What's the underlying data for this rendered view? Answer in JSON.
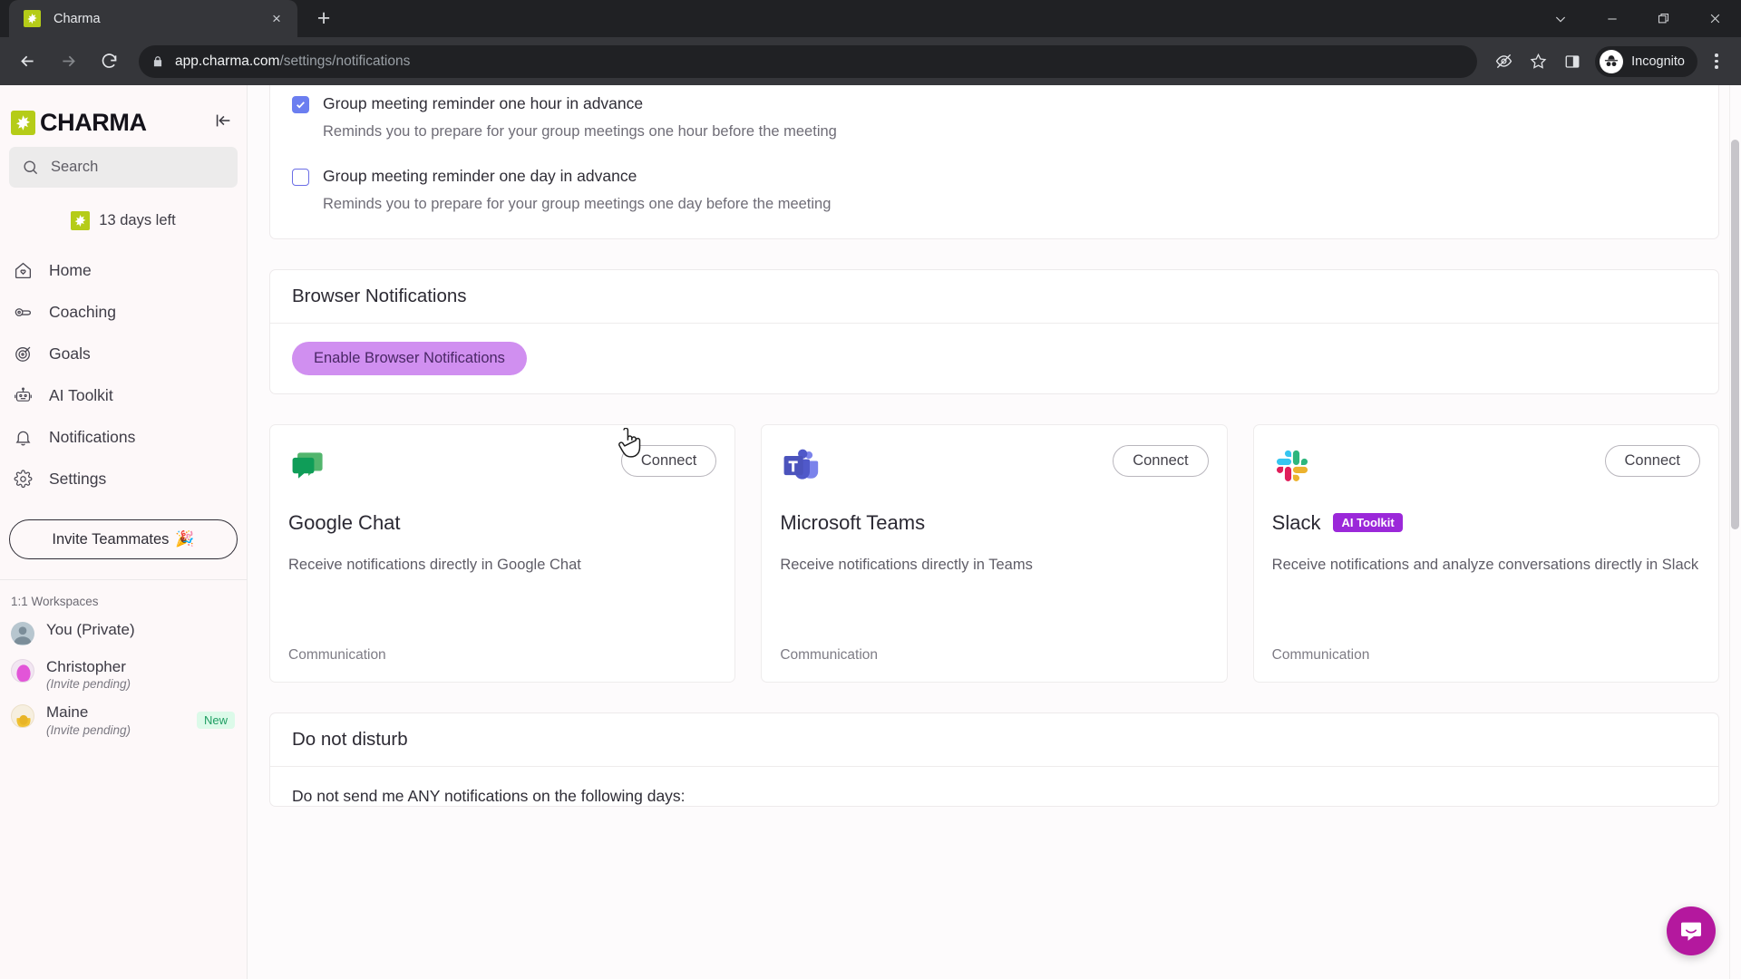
{
  "browser": {
    "tab": {
      "title": "Charma",
      "favicon": "charma-starburst-icon",
      "close": "×"
    },
    "new_tab_label": "+",
    "window_controls": {
      "dropdown": "chevron-down-icon",
      "minimize": "minimize-icon",
      "maximize": "maximize-icon",
      "close": "close-icon"
    },
    "url": {
      "domain": "app.charma.com",
      "path": "/settings/notifications"
    },
    "profile": {
      "label": "Incognito"
    },
    "toolbar_icons": [
      "eye-slash-icon",
      "star-icon",
      "side-panel-icon"
    ]
  },
  "sidebar": {
    "brand": "CHARMA",
    "collapse_icon": "collapse-left-icon",
    "search": {
      "placeholder": "Search"
    },
    "trial": "13 days left",
    "nav": [
      {
        "label": "Home",
        "icon": "home-icon"
      },
      {
        "label": "Coaching",
        "icon": "whistle-icon"
      },
      {
        "label": "Goals",
        "icon": "target-icon"
      },
      {
        "label": "AI Toolkit",
        "icon": "robot-icon"
      },
      {
        "label": "Notifications",
        "icon": "bell-icon"
      },
      {
        "label": "Settings",
        "icon": "gear-icon"
      }
    ],
    "invite_label": "Invite Teammates",
    "invite_emoji": "🎉",
    "workspaces_heading": "1:1 Workspaces",
    "workspaces": [
      {
        "name": "You (Private)",
        "sub": "",
        "badge": "",
        "avatar_color": "#9fb2bd"
      },
      {
        "name": "Christopher",
        "sub": "(Invite pending)",
        "badge": "",
        "avatar_color": "#e255d8"
      },
      {
        "name": "Maine",
        "sub": "(Invite pending)",
        "badge": "New",
        "avatar_color": "#f0c030"
      }
    ]
  },
  "main": {
    "meeting_options": [
      {
        "label": "Group meeting reminder one hour in advance",
        "desc": "Reminds you to prepare for your group meetings one hour before the meeting",
        "checked": true
      },
      {
        "label": "Group meeting reminder one day in advance",
        "desc": "Reminds you to prepare for your group meetings one day before the meeting",
        "checked": false
      }
    ],
    "browser_notifications": {
      "title": "Browser Notifications",
      "button_label": "Enable Browser Notifications",
      "button_color": "#d08ff0"
    },
    "integrations": [
      {
        "name": "Google Chat",
        "logo": "google-chat-icon",
        "connect_label": "Connect",
        "description": "Receive notifications directly in Google Chat",
        "category": "Communication",
        "badge": ""
      },
      {
        "name": "Microsoft Teams",
        "logo": "microsoft-teams-icon",
        "connect_label": "Connect",
        "description": "Receive notifications directly in Teams",
        "category": "Communication",
        "badge": ""
      },
      {
        "name": "Slack",
        "logo": "slack-icon",
        "connect_label": "Connect",
        "description": "Receive notifications and analyze conversations directly in Slack",
        "category": "Communication",
        "badge": "AI Toolkit"
      }
    ],
    "do_not_disturb": {
      "title": "Do not disturb",
      "line": "Do not send me ANY notifications on the following days:"
    }
  },
  "support": {
    "icon": "intercom-chat-icon",
    "color": "#b4189e"
  }
}
